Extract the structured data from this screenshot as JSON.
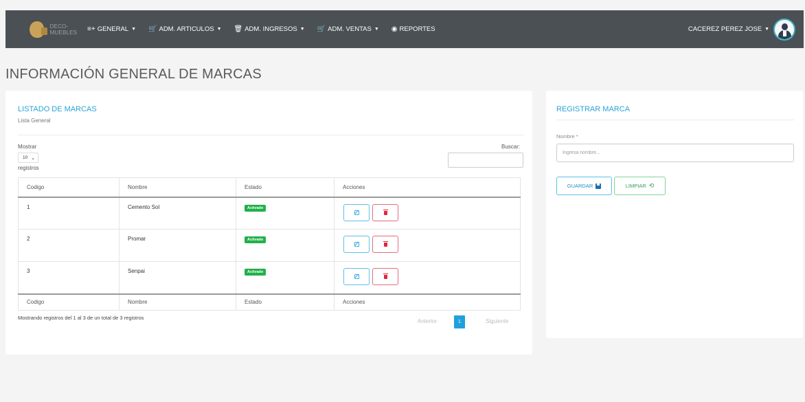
{
  "nav": {
    "brand": "DECO- MUEBLES",
    "items": [
      {
        "label": "GENERAL",
        "icon": "plus-list-icon"
      },
      {
        "label": "ADM. ARTICULOS",
        "icon": "cart-icon"
      },
      {
        "label": "ADM. INGRESOS",
        "icon": "basket-icon"
      },
      {
        "label": "ADM. VENTAS",
        "icon": "cart-icon"
      },
      {
        "label": "REPORTES",
        "icon": "eye-icon"
      }
    ],
    "user": "CACEREZ PEREZ JOSE"
  },
  "page": {
    "title": "INFORMACIÓN GENERAL DE MARCAS"
  },
  "list_card": {
    "title": "LISTADO DE MARCAS",
    "subtitle": "Lista General",
    "show_label": "Mostrar",
    "page_size": "10",
    "records_label": "registros",
    "search_label": "Buscar:",
    "columns": [
      "Codigo",
      "Nombre",
      "Estado",
      "Acciones"
    ],
    "rows": [
      {
        "code": "1",
        "name": "Cemento Sol",
        "status": "Activado"
      },
      {
        "code": "2",
        "name": "Promar",
        "status": "Activado"
      },
      {
        "code": "3",
        "name": "Senpai",
        "status": "Activado"
      }
    ],
    "info": "Mostrando registros del 1 al 3 de un total de 3 registros",
    "pagination": {
      "prev": "Anterior",
      "current": "1",
      "next": "Siguiente"
    }
  },
  "form_card": {
    "title": "REGISTRAR MARCA",
    "name_label": "Nombre *",
    "name_placeholder": "Ingresa nombre...",
    "save_label": "GUARDAR",
    "clear_label": "LIMPIAR"
  },
  "colors": {
    "navbar": "#4a5054",
    "accent": "#29a3d6",
    "badge": "#22b04a",
    "danger": "#e0263a"
  }
}
